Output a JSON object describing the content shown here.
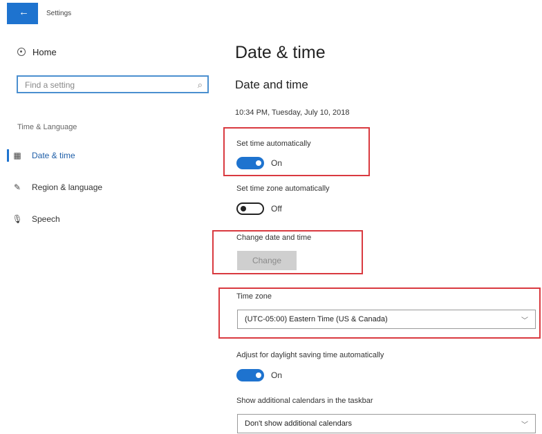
{
  "window": {
    "title": "Settings"
  },
  "sidebar": {
    "home_label": "Home",
    "search_placeholder": "Find a setting",
    "section_heading": "Time & Language",
    "items": [
      {
        "label": "Date & time",
        "icon": "calendar-clock-icon",
        "active": true
      },
      {
        "label": "Region & language",
        "icon": "region-language-icon",
        "active": false
      },
      {
        "label": "Speech",
        "icon": "microphone-icon",
        "active": false
      }
    ]
  },
  "main": {
    "page_title": "Date & time",
    "section_title": "Date and time",
    "current_datetime": "10:34 PM, Tuesday, July 10, 2018",
    "set_time_auto": {
      "label": "Set time automatically",
      "state_text": "On",
      "on": true
    },
    "set_timezone_auto": {
      "label": "Set time zone automatically",
      "state_text": "Off",
      "on": false
    },
    "change_datetime": {
      "label": "Change date and time",
      "button": "Change",
      "disabled": true
    },
    "time_zone": {
      "label": "Time zone",
      "value": "(UTC-05:00) Eastern Time (US & Canada)"
    },
    "daylight_saving": {
      "label": "Adjust for daylight saving time automatically",
      "state_text": "On",
      "on": true
    },
    "additional_calendars": {
      "label": "Show additional calendars in the taskbar",
      "value": "Don't show additional calendars"
    }
  },
  "colors": {
    "accent": "#1e73cf",
    "highlight_box": "#d9393f"
  }
}
